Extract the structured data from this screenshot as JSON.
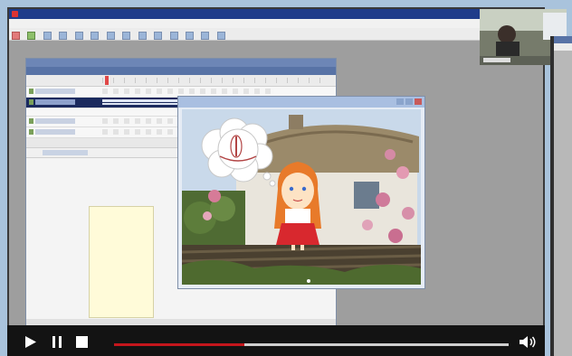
{
  "app": {
    "title": "",
    "menu": [
      "",
      "",
      "",
      "",
      "",
      "",
      ""
    ]
  },
  "player": {
    "progress_fraction": 0.33,
    "controls": [
      "play-icon",
      "pause-icon",
      "stop-icon",
      "volume-icon"
    ]
  },
  "colors": {
    "app_title_bar": "#1f3c8a",
    "progress_fill": "#c4161c",
    "control_bar": "#131313",
    "stage": "#fffbd9"
  }
}
